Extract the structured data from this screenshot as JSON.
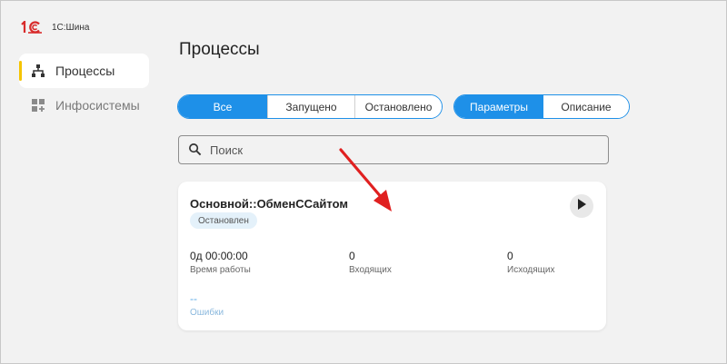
{
  "brand": {
    "name": "1С:Шина",
    "logo_color": "#d82b2b"
  },
  "sidebar": {
    "items": [
      {
        "label": "Процессы",
        "icon": "hierarchy-icon",
        "active": true
      },
      {
        "label": "Инфосистемы",
        "icon": "grid-plus-icon",
        "active": false
      }
    ]
  },
  "page": {
    "title": "Процессы"
  },
  "filters": {
    "state": [
      {
        "label": "Все",
        "active": true
      },
      {
        "label": "Запущено",
        "active": false
      },
      {
        "label": "Остановлено",
        "active": false
      }
    ],
    "view": [
      {
        "label": "Параметры",
        "active": true
      },
      {
        "label": "Описание",
        "active": false
      }
    ]
  },
  "search": {
    "placeholder": "Поиск",
    "value": ""
  },
  "process": {
    "title": "Основной::ОбменССайтом",
    "status": "Остановлен",
    "uptime_value": "0д 00:00:00",
    "uptime_label": "Время работы",
    "incoming_value": "0",
    "incoming_label": "Входящих",
    "outgoing_value": "0",
    "outgoing_label": "Исходящих",
    "errors_value": "--",
    "errors_label": "Ошибки"
  },
  "colors": {
    "accent": "#1e90e8",
    "active_marker": "#f5c400",
    "annotation_arrow": "#e02020"
  }
}
